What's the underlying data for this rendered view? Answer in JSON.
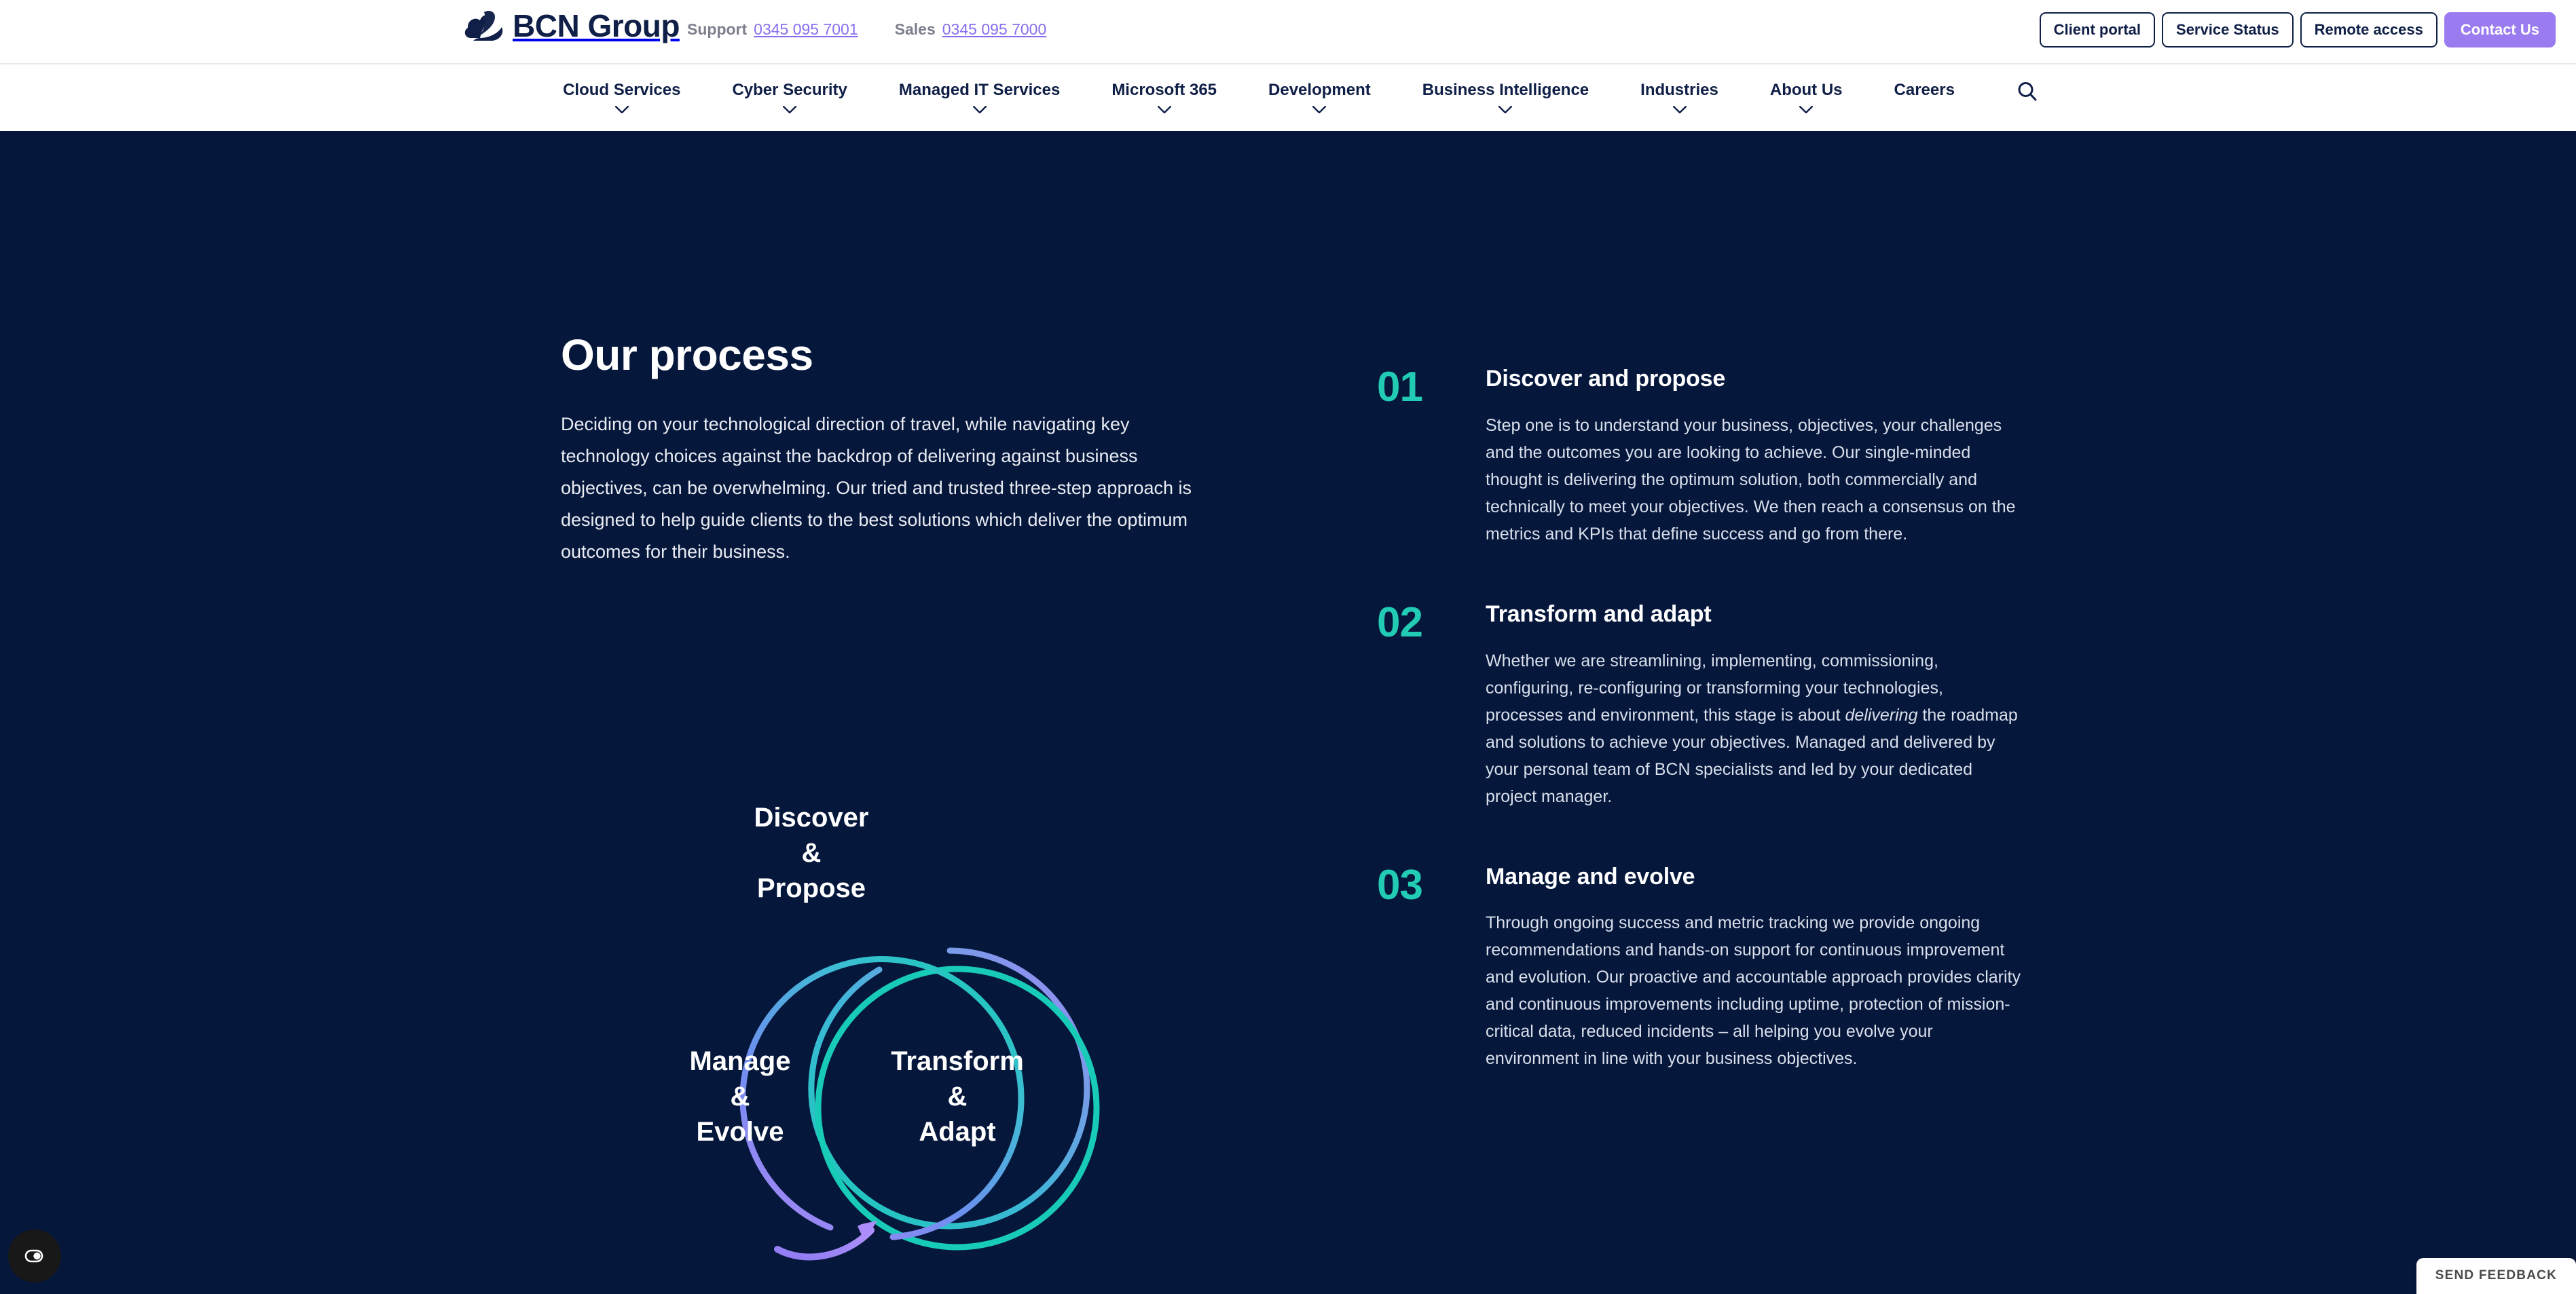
{
  "brand": {
    "logo_text": "BCN Group",
    "logo_icon": "cloud-logo-icon",
    "logo_color": "#101f47"
  },
  "topbar": {
    "support_label": "Support",
    "support_number": "0345 095 7001",
    "sales_label": "Sales",
    "sales_number": "0345 095 7000",
    "phone_link_color": "#8b6cf0",
    "buttons": [
      {
        "label": "Client portal",
        "style": "outline"
      },
      {
        "label": "Service Status",
        "style": "outline"
      },
      {
        "label": "Remote access",
        "style": "outline"
      },
      {
        "label": "Contact Us",
        "style": "filled",
        "color": "#9b7cf0"
      }
    ]
  },
  "nav": {
    "items": [
      {
        "label": "Cloud Services",
        "has_dropdown": true
      },
      {
        "label": "Cyber Security",
        "has_dropdown": true
      },
      {
        "label": "Managed IT Services",
        "has_dropdown": true
      },
      {
        "label": "Microsoft 365",
        "has_dropdown": true
      },
      {
        "label": "Development",
        "has_dropdown": true
      },
      {
        "label": "Business Intelligence",
        "has_dropdown": true
      },
      {
        "label": "Industries",
        "has_dropdown": true
      },
      {
        "label": "About Us",
        "has_dropdown": true
      },
      {
        "label": "Careers",
        "has_dropdown": false
      }
    ],
    "search_icon": "search-icon"
  },
  "section": {
    "background_color": "#06173c",
    "title": "Our process",
    "intro": "Deciding on your technological direction of travel, while navigating key technology choices against the backdrop of delivering against business objectives, can be overwhelming. Our tried and trusted three-step approach is designed to help guide clients to the best solutions which deliver the optimum outcomes for their business."
  },
  "diagram": {
    "accent_teal": "#21cbb4",
    "accent_purple": "#9b7cf0",
    "circles": [
      {
        "id": "discover",
        "label": "Discover\n&\nPropose"
      },
      {
        "id": "manage",
        "label": "Manage\n&\nEvolve"
      },
      {
        "id": "transform",
        "label": "Transform\n&\nAdapt"
      }
    ],
    "arrow_icon": "curved-arrow-icon"
  },
  "steps": [
    {
      "number": "01",
      "title": "Discover and propose",
      "text": "Step one is to understand your business, objectives, your challenges and the outcomes you are looking to achieve. Our single-minded thought is delivering the optimum solution, both commercially and technically to meet your objectives. We then reach a consensus on the metrics and KPIs that define success and go from there."
    },
    {
      "number": "02",
      "title": "Transform and adapt",
      "text_before_italic": "Whether we are streamlining, implementing, commissioning, configuring, re-configuring or transforming your technologies, processes and environment, this stage is about ",
      "text_italic": "delivering",
      "text_after_italic": " the roadmap and solutions to achieve your objectives. Managed and delivered by your personal team of BCN specialists and led by your dedicated project manager."
    },
    {
      "number": "03",
      "title": "Manage and evolve",
      "text": "Through ongoing success and metric tracking we provide ongoing recommendations and hands-on support for continuous improvement and evolution. Our proactive and accountable approach provides clarity and continuous improvements including uptime, protection of mission-critical data, reduced incidents – all helping you evolve your environment in line with your business objectives."
    }
  ],
  "widgets": {
    "accessibility_icon": "accessibility-toggle-icon",
    "feedback_label": "SEND FEEDBACK"
  }
}
